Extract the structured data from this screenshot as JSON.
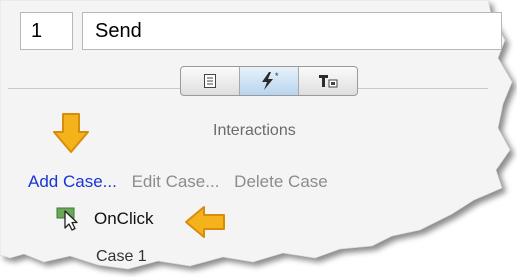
{
  "case_fields": {
    "id_value": "1",
    "name_value": "Send"
  },
  "toolbar": {
    "buttons": [
      {
        "icon": "page-icon",
        "active": false
      },
      {
        "icon": "lightning-icon",
        "active": true
      },
      {
        "icon": "text-style-icon",
        "active": false
      }
    ]
  },
  "interactions": {
    "title": "Interactions",
    "add_case": "Add Case...",
    "edit_case": "Edit Case...",
    "delete_case": "Delete Case"
  },
  "event": {
    "label": "OnClick",
    "icon": "cursor-event-icon"
  },
  "case_peek": "Case 1",
  "colors": {
    "add_case": "#1a34d6",
    "disabled_text": "#8c8c8c",
    "arrow_fill": "#f4b21b",
    "arrow_stroke": "#d98c0c"
  }
}
